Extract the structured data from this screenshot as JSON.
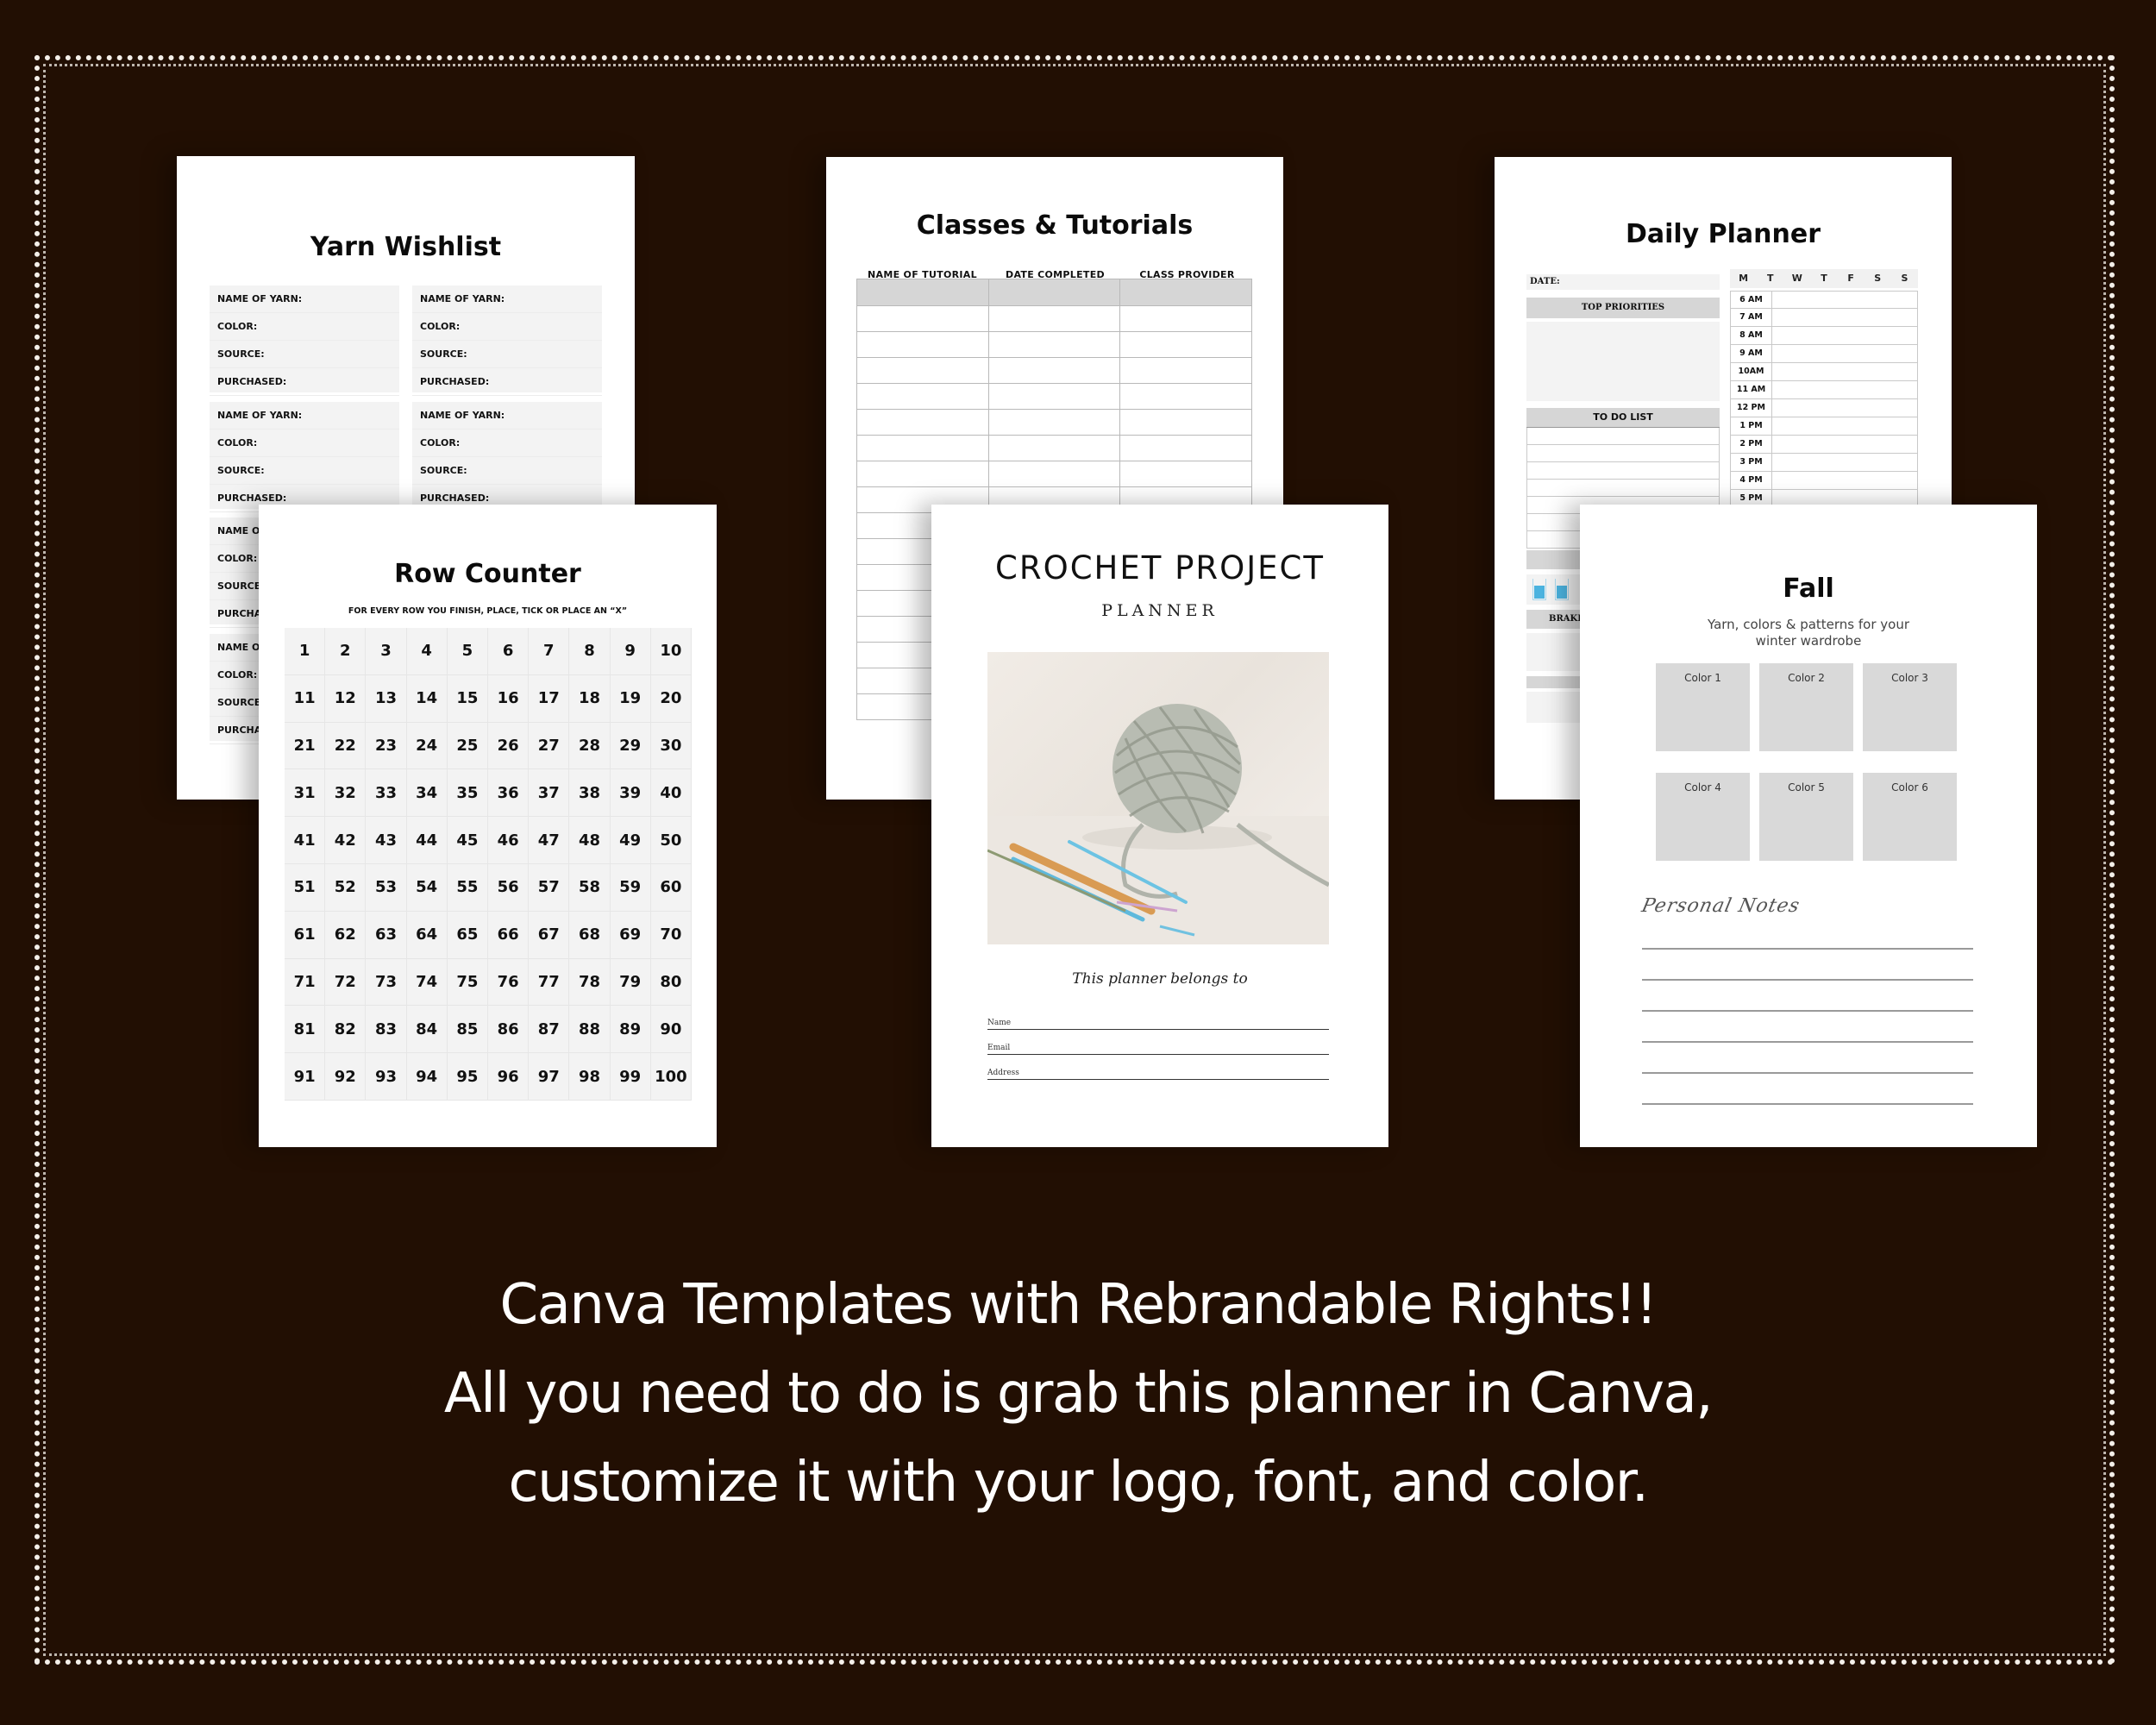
{
  "colors": {
    "background": "#220f03",
    "border_dots": "#f4efe9",
    "page": "#ffffff",
    "cell_gray": "#f3f3f3",
    "header_gray": "#d6d6d6",
    "swatch_gray": "#d9d9d9",
    "water_blue": "#4bb3df"
  },
  "yarn_wishlist": {
    "title": "Yarn Wishlist",
    "field_labels": [
      "NAME OF YARN:",
      "COLOR:",
      "SOURCE:",
      "PURCHASED:"
    ],
    "box_count": 8
  },
  "row_counter": {
    "title": "Row Counter",
    "instruction": "FOR EVERY ROW YOU FINISH, PLACE, TICK OR PLACE AN “X”",
    "numbers_from": 1,
    "numbers_to": 100
  },
  "classes": {
    "title": "Classes & Tutorials",
    "columns": [
      "NAME OF TUTORIAL",
      "DATE COMPLETED",
      "CLASS PROVIDER"
    ]
  },
  "daily_planner": {
    "title": "Daily Planner",
    "date_label": "DATE:",
    "top_priorities": "TOP PRIORITIES",
    "todo": "TO DO LIST",
    "breakfast_partial": "BRAKF",
    "days": [
      "M",
      "T",
      "W",
      "T",
      "F",
      "S",
      "S"
    ],
    "times": [
      "6 AM",
      "7 AM",
      "8 AM",
      "9 AM",
      "10AM",
      "11 AM",
      "12 PM",
      "1 PM",
      "2 PM",
      "3 PM",
      "4 PM",
      "5 PM"
    ]
  },
  "cover": {
    "title": "CROCHET PROJECT",
    "subtitle": "PLANNER",
    "belongs": "This planner belongs to",
    "fields": [
      "Name",
      "Email",
      "Address"
    ]
  },
  "fall": {
    "title": "Fall",
    "subtitle_line1": "Yarn, colors & patterns for your",
    "subtitle_line2": "winter wardrobe",
    "swatches": [
      "Color 1",
      "Color 2",
      "Color 3",
      "Color 4",
      "Color 5",
      "Color 6"
    ],
    "notes_heading": "Personal Notes"
  },
  "caption": {
    "line1": "Canva Templates with Rebrandable Rights!!",
    "line2": "All you need to do is grab this planner in Canva,",
    "line3": "customize it with your logo, font, and color."
  }
}
